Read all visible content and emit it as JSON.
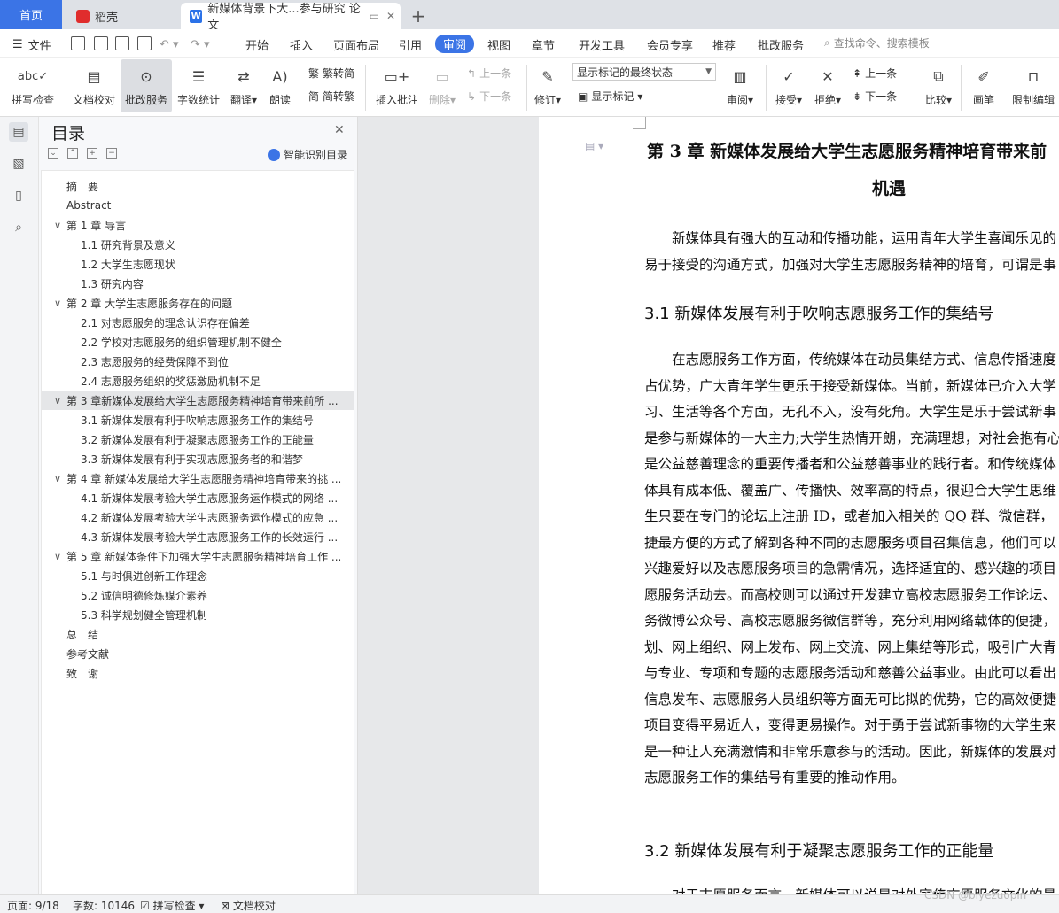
{
  "tabs": {
    "home": "首页",
    "daoke": "稻壳",
    "doc": "新媒体背景下大...参与研究 论文",
    "plus": "+"
  },
  "menu": {
    "file": "文件",
    "items": [
      "开始",
      "插入",
      "页面布局",
      "引用",
      "审阅",
      "视图",
      "章节",
      "开发工具",
      "会员专享",
      "推荐",
      "批改服务"
    ],
    "search": "查找命令、搜索模板"
  },
  "toolbar": {
    "spell": "拼写检查",
    "doccheck": "文档校对",
    "correct": "批改服务",
    "count": "字数统计",
    "translate": "翻译",
    "read": "朗读",
    "trad": "繁转简",
    "simp": "简转繁",
    "insert_comment": "插入批注",
    "delete": "删除",
    "prev": "上一条",
    "next": "下一条",
    "track": "修订",
    "markup_select": "显示标记的最终状态",
    "show_markup": "显示标记",
    "review": "审阅",
    "accept": "接受",
    "reject": "拒绝",
    "prev2": "上一条",
    "next2": "下一条",
    "compare": "比较",
    "pen": "画笔",
    "restrict": "限制编辑"
  },
  "panel": {
    "title": "目录",
    "smart": "智能识别目录",
    "toc": [
      {
        "text": "摘　要",
        "level": 0
      },
      {
        "text": "Abstract",
        "level": 0
      },
      {
        "text": "第 1 章  导言",
        "level": 0,
        "chev": "∨"
      },
      {
        "text": "1.1 研究背景及意义",
        "level": 1
      },
      {
        "text": "1.2 大学生志愿现状",
        "level": 1
      },
      {
        "text": "1.3 研究内容",
        "level": 1
      },
      {
        "text": "第 2 章  大学生志愿服务存在的问题",
        "level": 0,
        "chev": "∨"
      },
      {
        "text": "2.1 对志愿服务的理念认识存在偏差",
        "level": 1
      },
      {
        "text": "2.2 学校对志愿服务的组织管理机制不健全",
        "level": 1
      },
      {
        "text": "2.3 志愿服务的经费保障不到位",
        "level": 1
      },
      {
        "text": "2.4 志愿服务组织的奖惩激励机制不足",
        "level": 1
      },
      {
        "text": "第 3 章新媒体发展给大学生志愿服务精神培育带来前所 ...",
        "level": 0,
        "chev": "∨",
        "sel": true
      },
      {
        "text": "3.1 新媒体发展有利于吹响志愿服务工作的集结号",
        "level": 1
      },
      {
        "text": "3.2 新媒体发展有利于凝聚志愿服务工作的正能量",
        "level": 1
      },
      {
        "text": "3.3 新媒体发展有利于实现志愿服务者的和谐梦",
        "level": 1
      },
      {
        "text": "第 4 章  新媒体发展给大学生志愿服务精神培育带来的挑 ...",
        "level": 0,
        "chev": "∨"
      },
      {
        "text": "4.1 新媒体发展考验大学生志愿服务运作模式的网络 ...",
        "level": 1
      },
      {
        "text": "4.2 新媒体发展考验大学生志愿服务运作模式的应急 ...",
        "level": 1
      },
      {
        "text": "4.3 新媒体发展考验大学生志愿服务工作的长效运行 ...",
        "level": 1
      },
      {
        "text": "第 5 章  新媒体条件下加强大学生志愿服务精神培育工作 ...",
        "level": 0,
        "chev": "∨"
      },
      {
        "text": "5.1 与时俱进创新工作理念",
        "level": 1
      },
      {
        "text": "5.2 诚信明德修炼媒介素养",
        "level": 1
      },
      {
        "text": "5.3 科学规划健全管理机制",
        "level": 1
      },
      {
        "text": "总　结",
        "level": 0
      },
      {
        "text": "参考文献",
        "level": 0
      },
      {
        "text": "致　谢",
        "level": 0
      }
    ]
  },
  "document": {
    "chapter_title_line1": "第 3 章  新媒体发展给大学生志愿服务精神培育带来前",
    "chapter_title_line2": "机遇",
    "intro": [
      "　　新媒体具有强大的互动和传播功能，运用青年大学生喜闻乐见的",
      "易于接受的沟通方式，加强对大学生志愿服务精神的培育，可谓是事"
    ],
    "h31": "3.1 新媒体发展有利于吹响志愿服务工作的集结号",
    "para31": [
      "　　在志愿服务工作方面，传统媒体在动员集结方式、信息传播速度",
      "占优势，广大青年学生更乐于接受新媒体。当前，新媒体已介入大学",
      "习、生活等各个方面，无孔不入，没有死角。大学生是乐于尝试新事",
      "是参与新媒体的一大主力;大学生热情开朗，充满理想，对社会抱有心",
      "是公益慈善理念的重要传播者和公益慈善事业的践行者。和传统媒体",
      "体具有成本低、覆盖广、传播快、效率高的特点，很迎合大学生思维",
      "生只要在专门的论坛上注册 ID，或者加入相关的 QQ 群、微信群，",
      "捷最方便的方式了解到各种不同的志愿服务项目召集信息，他们可以",
      "兴趣爱好以及志愿服务项目的急需情况，选择适宜的、感兴趣的项目",
      "愿服务活动去。而高校则可以通过开发建立高校志愿服务工作论坛、",
      "务微博公众号、高校志愿服务微信群等，充分利用网络载体的便捷，",
      "划、网上组织、网上发布、网上交流、网上集结等形式，吸引广大青",
      "与专业、专项和专题的志愿服务活动和慈善公益事业。由此可以看出",
      "信息发布、志愿服务人员组织等方面无可比拟的优势，它的高效便捷",
      "项目变得平易近人，变得更易操作。对于勇于尝试新事物的大学生来",
      "是一种让人充满激情和非常乐意参与的活动。因此，新媒体的发展对",
      "志愿服务工作的集结号有重要的推动作用。"
    ],
    "h32": "3.2 新媒体发展有利于凝聚志愿服务工作的正能量",
    "para32_first": "　　对于志愿服务而言，新媒体可以说是对外宣传志愿服务文化的最"
  },
  "status": {
    "page": "页面: 9/18",
    "words": "字数: 10146",
    "spell": "拼写检查",
    "doccheck": "文档校对",
    "watermark": "CSDN @biyezuopin"
  },
  "colors": {
    "accent": "#3b74e6"
  }
}
